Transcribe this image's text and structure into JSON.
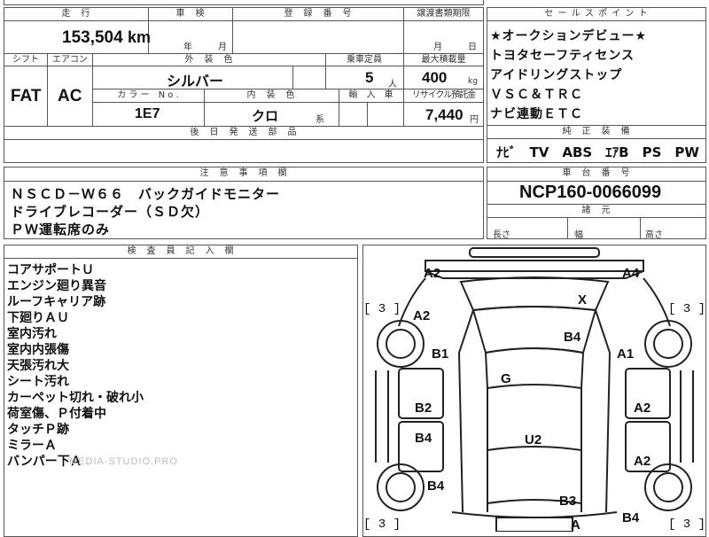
{
  "top_table": {
    "mileage_label": "走　行",
    "mileage_value": "153,504",
    "mileage_unit": "km",
    "inspection_label": "車　検",
    "inspection_year": "年",
    "inspection_month": "月",
    "reg_no_label": "登　録　番　号",
    "doc_deadline_label": "譲渡書類期限",
    "doc_month": "月",
    "doc_day": "日",
    "shift_label": "シフト",
    "aircon_label": "エアコン",
    "ext_color_label": "外　装　色",
    "capacity_label": "乗車定員",
    "max_load_label": "最大積載量",
    "shift_value": "FAT",
    "aircon_value": "AC",
    "ext_color_value": "シルバー",
    "capacity_value": "5",
    "capacity_unit": "人",
    "max_load_value": "400",
    "max_load_unit": "kg",
    "color_no_label": "カ ラ ー　N o .",
    "int_color_label": "内　装　色",
    "import_label": "輸　入　車",
    "recycle_label": "リサイクル預託金",
    "color_no_value": "1E7",
    "int_color_value": "クロ",
    "int_color_suffix": "系",
    "recycle_value": "7,440",
    "recycle_unit": "円",
    "later_parts_label": "後　日　発　送　部　品"
  },
  "sales_points": {
    "title": "セ ー ル ス ポ イ ン ト",
    "lines": [
      "★オークションデビュー★",
      "トヨタセーフティセンス",
      "アイドリングストップ",
      "ＶＳＣ＆ＴＲＣ",
      "ナビ連動ＥＴＣ"
    ]
  },
  "equipment": {
    "title": "純　正　装　備",
    "items": "ﾅﾋﾞ　TV　ABS　ｴｱB　PS　PW"
  },
  "notes": {
    "title": "注　意　事　項　欄",
    "lines": [
      "ＮＳＣＤ－Ｗ６６　バックガイドモニター",
      "ドライブレコーダー（ＳＤ欠）",
      "ＰＷ運転席のみ"
    ]
  },
  "chassis": {
    "title": "車　台　番　号",
    "value": "NCP160-0066099",
    "dims_title": "諸　元",
    "length_label": "長さ",
    "width_label": "幅",
    "height_label": "高さ"
  },
  "inspector": {
    "title": "検　査　員　記　入　欄",
    "lines": [
      "コアサポートＵ",
      "エンジン廻り異音",
      "ルーフキャリア跡",
      "下廻りＡＵ",
      "室内汚れ",
      "室内内張傷",
      "天張汚れ大",
      "シート汚れ",
      "カーペット切れ・破れ小",
      "荷室傷、Ｐ付着中",
      "タッチＰ跡",
      "ミラーＡ",
      "バンパー下Ａ"
    ],
    "watermark": "MEDIA-STUDIO.PRO"
  },
  "damage_map": {
    "tire_marks": [
      "[ 3 ]",
      "[ 3 ]",
      "[ 3 ]",
      "[ 3 ]"
    ],
    "codes": [
      "A2",
      "A4",
      "X",
      "A2",
      "B4",
      "B1",
      "A1",
      "G",
      "B2",
      "A2",
      "B4",
      "U2",
      "A2",
      "B4",
      "B3",
      "B4",
      "A"
    ]
  }
}
